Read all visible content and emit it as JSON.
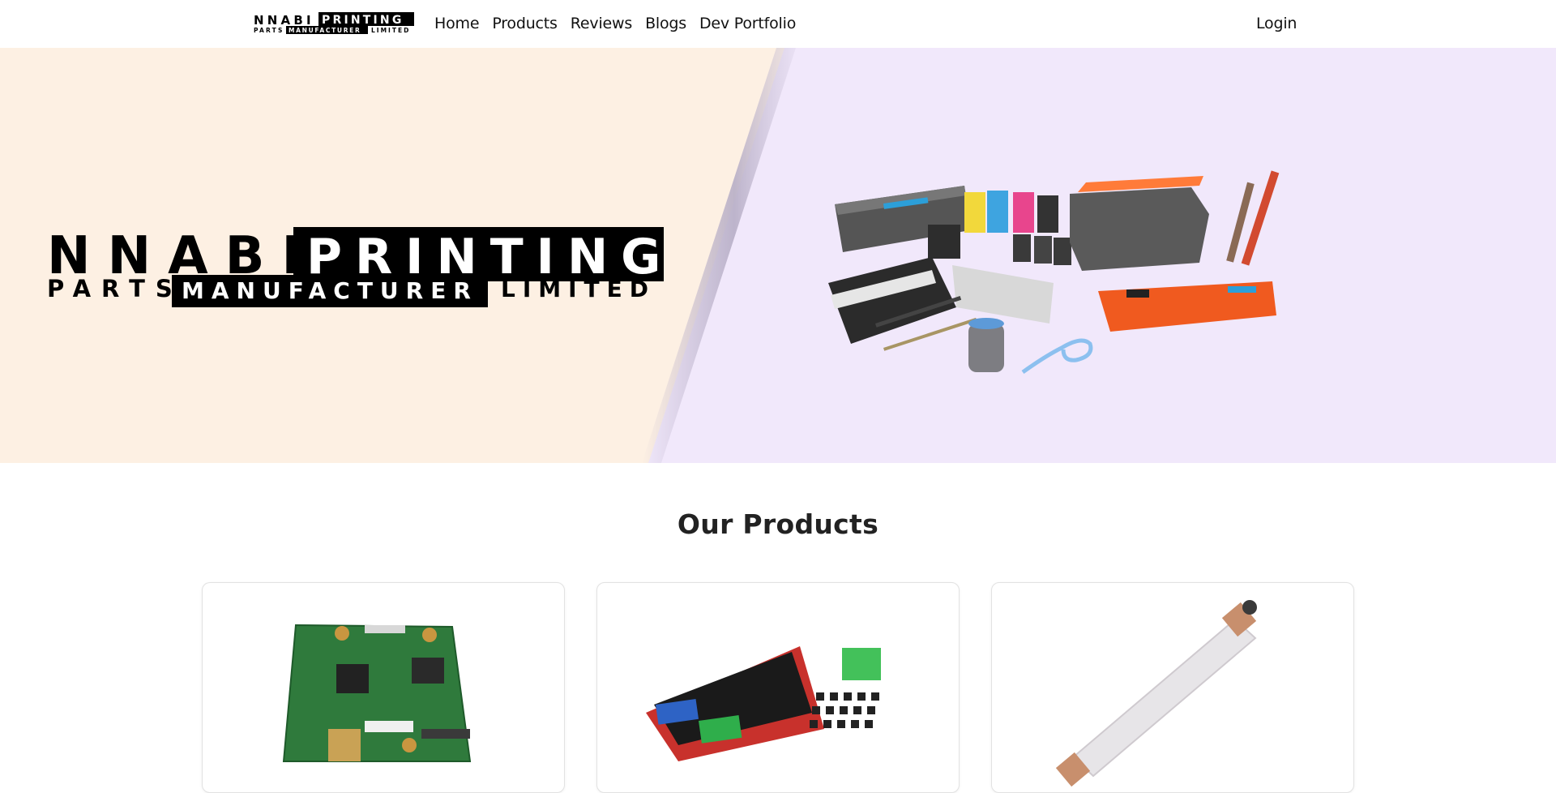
{
  "brand": {
    "logo_line1_a": "NNABI",
    "logo_line1_b": "PRINTING",
    "logo_line2_a": "PARTS",
    "logo_line2_b": "MANUFACTURER",
    "logo_line2_c": "LIMITED"
  },
  "nav": {
    "items": [
      {
        "label": "Home"
      },
      {
        "label": "Products"
      },
      {
        "label": "Reviews"
      },
      {
        "label": "Blogs"
      },
      {
        "label": "Dev Portfolio"
      }
    ],
    "login_label": "Login"
  },
  "hero": {
    "left_bg": "#fdf0e3",
    "right_bg": "#f1e8fb"
  },
  "products": {
    "title": "Our Products",
    "cards": [
      {
        "image": "formatter-board-image"
      },
      {
        "image": "controller-board-image"
      },
      {
        "image": "fuser-roller-image"
      }
    ]
  }
}
